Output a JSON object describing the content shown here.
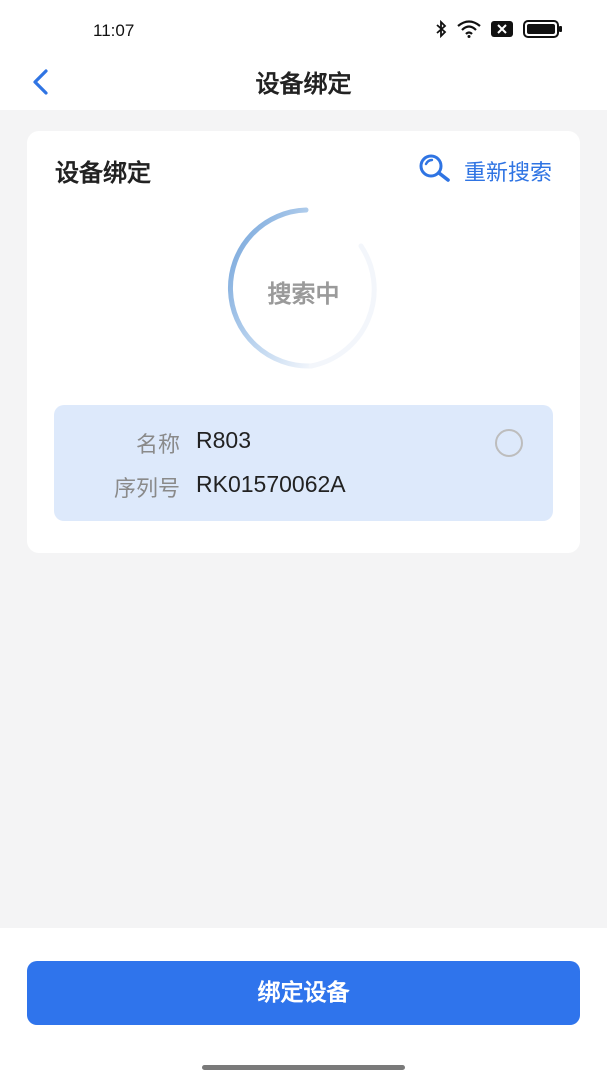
{
  "status_bar": {
    "time": "11:07",
    "icons": [
      "bluetooth-icon",
      "wifi-icon",
      "sim-x-icon",
      "battery-icon"
    ]
  },
  "nav": {
    "back_icon": "chevron-left-icon",
    "title": "设备绑定"
  },
  "card": {
    "title": "设备绑定",
    "research_label": "重新搜索",
    "research_icon": "search-icon",
    "searching_text": "搜索中",
    "devices": [
      {
        "name_label": "名称",
        "name_value": "R803",
        "serial_label": "序列号",
        "serial_value": "RK01570062A",
        "selected": false
      }
    ]
  },
  "footer": {
    "bind_button_label": "绑定设备"
  },
  "colors": {
    "accent": "#2f74ec",
    "device_bg": "#dde9fb",
    "page_bg": "#f4f4f5"
  }
}
